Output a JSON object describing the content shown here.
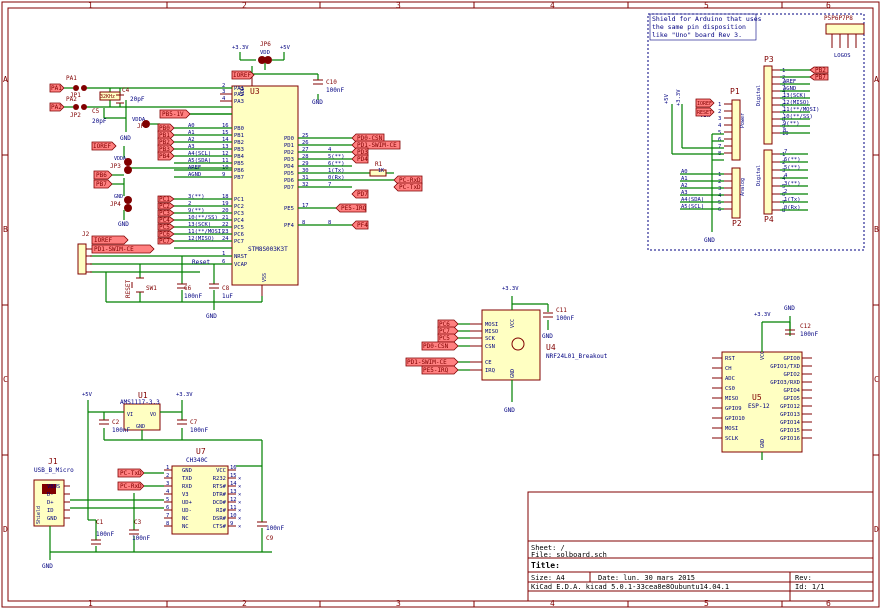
{
  "sheet": {
    "columns": [
      "1",
      "2",
      "3",
      "4",
      "5",
      "6"
    ],
    "rows": [
      "A",
      "B",
      "C",
      "D"
    ]
  },
  "title_block": {
    "sheet": "Sheet: /",
    "file": "File: solboard.sch",
    "title": "Title:",
    "size": "Size: A4",
    "date": "Date: lun. 30 mars 2015",
    "rev": "Rev:",
    "tool": "KiCad E.D.A.  kicad 5.0.1-33cea8e8Oubuntu14.04.1",
    "id": "Id: 1/1"
  },
  "note": {
    "lines": [
      "Shield for Arduino that uses",
      "the same pin disposition",
      "like \"Uno\" board Rev 3."
    ]
  },
  "header_p5": {
    "ref": "P5P6P7P8",
    "name": "LOGOS"
  },
  "mcu": {
    "ref": "U3",
    "value": "STM8S003K3T",
    "left_pins": [
      "PA1",
      "PA2",
      "PA3",
      "PB0",
      "PB1",
      "PB2",
      "PB3",
      "PB4",
      "PB5",
      "PB6",
      "PB7",
      "PC1",
      "PC2",
      "PC3",
      "PC4",
      "PC5",
      "PC6",
      "PC7",
      "NRST",
      "VCAP"
    ],
    "left_nums": [
      "2",
      "3",
      "4",
      "16",
      "15",
      "14",
      "13",
      "12",
      "11",
      "10",
      "9",
      "18",
      "19",
      "20",
      "21",
      "22",
      "23",
      "24",
      "1",
      "6"
    ],
    "right_pins": [
      "PD0",
      "PD1",
      "PD2",
      "PD3",
      "PD4",
      "PD5",
      "PD6",
      "PD7",
      "PE5",
      "PF4"
    ],
    "right_nums": [
      "25",
      "26",
      "27",
      "28",
      "29",
      "30",
      "31",
      "32",
      "17",
      "8"
    ],
    "top_pin": "VDD",
    "bottom_pin": "VSS",
    "nets_left": [
      "A0",
      "A1",
      "A2",
      "A3",
      "A4(SCL)",
      "A5(SDA)",
      "AREF",
      "AGND",
      "3(**)",
      "2",
      "9(**)",
      "10(**/SS)",
      "13(SCK)",
      "11(**/MOSI)",
      "12(MISO)"
    ],
    "nets_right": [
      "4",
      "5(**)",
      "6(**)",
      "1(Tx)",
      "0(Rx)",
      "7",
      "8"
    ],
    "reset_label": "Reset"
  },
  "components": {
    "pa1": "PA1",
    "pa2": "PA2",
    "jp1": "JP1",
    "jp2": "JP2",
    "x1": "32KHz",
    "c4": "C4",
    "c4v": "20pF",
    "c5": "C5",
    "c5v": "20pF",
    "jp5": "JP5",
    "vdda": "VDDA",
    "jp6": "JP6",
    "vdd": "VDD",
    "v33": "+3.3V",
    "v5": "+5V",
    "c10": "C10",
    "c10v": "100nF",
    "ioref": "IOREF",
    "jp3": "JP3",
    "jp4": "JP4",
    "r1": "R1",
    "r1v": "1K",
    "j2": "J2",
    "sw1": "SW1",
    "reset": "RESET",
    "c6": "C6",
    "c6v": "100nF",
    "c8": "C8",
    "c8v": "1uF",
    "gnd": "GND"
  },
  "labels": {
    "ioref": "IOREF",
    "pb5_1v": "PB5-1V",
    "pb6": "PB6",
    "pb7": "PB7",
    "pd0": "PD0-CSN",
    "pd1": "PD1-SWIM-CE",
    "pd3": "PD3",
    "pd4": "PD4",
    "pcrx": "PC-RxD",
    "pctx": "PC-TxD",
    "pd7": "PD7",
    "pe5": "PE5-IRQ",
    "pf4": "PF4",
    "pc1": "PC1",
    "pc2": "PC2",
    "pc3": "PC3",
    "pc4": "PC4",
    "pc5": "PC5",
    "pc6": "PC6",
    "pc7": "PC7",
    "pd1b": "PD1-SWIM-CE",
    "pb0": "PB0",
    "pb1": "PB1",
    "pb2": "PB2",
    "pb3": "PB3",
    "pb4": "PB4",
    "ioref2": "IOREF"
  },
  "arduino": {
    "p1": {
      "ref": "P1",
      "value": "Power",
      "pins": [
        "1",
        "2",
        "3",
        "4",
        "5",
        "6",
        "7",
        "8"
      ]
    },
    "p3": {
      "ref": "P3",
      "value": "Digital",
      "pins": [
        "1",
        "2",
        "3",
        "4",
        "5",
        "6",
        "7",
        "8",
        "9",
        "10"
      ],
      "nets": [
        "PB2",
        "PB7",
        "AREF",
        "AGND",
        "13(SCK)",
        "12(MISO)",
        "11(**/MOSI)",
        "10(**/SS)",
        "9(**)",
        "8"
      ]
    },
    "p2": {
      "ref": "P2",
      "value": "Analog",
      "pins": [
        "1",
        "2",
        "3",
        "4",
        "5",
        "6"
      ],
      "nets": [
        "A0",
        "A1",
        "A2",
        "A3",
        "A4(SDA)",
        "A5(SCL)"
      ]
    },
    "p4": {
      "ref": "P4",
      "value": "Digital",
      "pins": [
        "1",
        "2",
        "3",
        "4",
        "5",
        "6",
        "7",
        "8"
      ],
      "nets": [
        "7",
        "6(**)",
        "5(**)",
        "4",
        "3(**)",
        "2",
        "1(Tx)",
        "0(Rx)"
      ]
    },
    "p1_labels": [
      "IOREF",
      "RESET"
    ],
    "v33": "+3.3V",
    "v5": "+5V",
    "vin": "VIN",
    "gnd": "GND"
  },
  "nrf": {
    "ref": "U4",
    "value": "NRF24L01_Breakout",
    "pins": [
      "MOSI",
      "MISO",
      "SCK",
      "CSN",
      "CE",
      "IRQ"
    ],
    "vcc": "VCC",
    "gnd": "GND",
    "labels": [
      "PC6",
      "PC7",
      "PC5",
      "PD0-CSN",
      "PD1-SWIM-CE",
      "PE5-IRQ"
    ],
    "c11": "C11",
    "c11v": "100nF",
    "v33": "+3.3V"
  },
  "esp": {
    "ref": "U5",
    "value": "ESP-12",
    "left": [
      "RST",
      "CH",
      "ADC",
      "CS0",
      "MISO",
      "GPIO9",
      "GPIO10",
      "MOSI",
      "SCLK"
    ],
    "right": [
      "GPIO0",
      "GPIO1/TXD",
      "GPIO2",
      "GPIO3/RXD",
      "GPIO4",
      "GPIO5",
      "GPIO12",
      "GPIO13",
      "GPIO14",
      "GPIO15",
      "GPIO16"
    ],
    "vcc": "VCC",
    "gnd": "GND",
    "c12": "C12",
    "c12v": "100nF",
    "v33": "+3.3V"
  },
  "usb": {
    "ref": "J1",
    "value": "USB_B_Micro",
    "pins": [
      "VBUS",
      "D-",
      "D+",
      "ID",
      "GND"
    ],
    "shield": "Shield"
  },
  "reg": {
    "ref": "U1",
    "value": "AMS1117-3.3",
    "vi": "VI",
    "vo": "VO",
    "gnd": "GND",
    "c2": "C2",
    "c2v": "100nF",
    "c7": "C7",
    "c7v": "100nF",
    "v5": "+5V",
    "v33": "+3.3V"
  },
  "ch340": {
    "ref": "U7",
    "value": "CH340C",
    "left": [
      "GND",
      "TXD",
      "RXD",
      "V3",
      "UD+",
      "UD-",
      "NC",
      "NC"
    ],
    "right": [
      "VCC",
      "R232",
      "RTS#",
      "DTR#",
      "DCD#",
      "RI#",
      "DSR#",
      "CTS#"
    ],
    "left_nums": [
      "1",
      "2",
      "3",
      "4",
      "5",
      "6",
      "7",
      "8"
    ],
    "right_nums": [
      "16",
      "15",
      "14",
      "13",
      "12",
      "11",
      "10",
      "9"
    ],
    "labels": [
      "PC-TxD",
      "PC-RxD"
    ],
    "c1": "C1",
    "c1v": "100nF",
    "c3": "C3",
    "c3v": "100nF",
    "c9": "C9",
    "c9v": "100nF"
  }
}
